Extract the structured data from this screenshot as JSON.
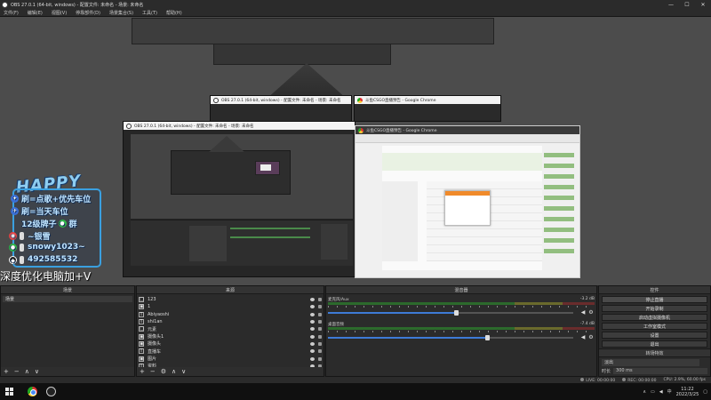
{
  "window": {
    "title": "OBS 27.0.1 (64-bit, windows) - 配置文件: 未命名 - 场景: 未命名",
    "controls": [
      "—",
      "☐",
      "✕"
    ]
  },
  "menu": [
    "文件(F)",
    "编辑(E)",
    "视图(V)",
    "停靠部件(D)",
    "场景集合(S)",
    "工具(T)",
    "帮助(H)"
  ],
  "preview": {
    "obs_window_title": "OBS 27.0.1 (64-bit, windows) - 配置文件: 未命名 - 场景: 未命名",
    "chrome_window_title": "斗鱼CSGO直播预告 - Google Chrome",
    "mini_obs_title": "OBS 27.0.1 (64-bit, windows) - 配置文件: 未命名 - 场景: 未命名",
    "mini_chrome_title": "斗鱼CSGO直播预告 - Google Chrome",
    "streamer": {
      "logo": "HAPPY",
      "lines": [
        "刷=点歌+优先车位",
        "刷=当天车位",
        "12级牌子",
        "~银雪",
        "snowy1023~",
        "492585532"
      ],
      "group_label": "群"
    },
    "caption": "深度优化电脑加+V"
  },
  "docks": {
    "scenes": {
      "header": "场景",
      "items": [
        "场景"
      ]
    },
    "sources": {
      "header": "来源",
      "items": [
        {
          "label": "123",
          "icon": "□"
        },
        {
          "label": "1",
          "icon": "▣"
        },
        {
          "label": "Abiyaoshi",
          "icon": "T"
        },
        {
          "label": "shi1an",
          "icon": "T"
        },
        {
          "label": "元素",
          "icon": "▢"
        },
        {
          "label": "摄像头1",
          "icon": "▣"
        },
        {
          "label": "摄像头",
          "icon": "▣"
        },
        {
          "label": "直播车",
          "icon": "T"
        },
        {
          "label": "图片",
          "icon": "▣"
        },
        {
          "label": "资料",
          "icon": "T"
        }
      ]
    },
    "mixer": {
      "header": "混音器",
      "channels": [
        {
          "label": "麦克风/Aux",
          "db": "-3.2 dB",
          "level": 0.52
        },
        {
          "label": "桌面音频",
          "db": "-7.4 dB",
          "level": 0.65
        }
      ]
    },
    "controls": {
      "header": "控件",
      "buttons": [
        "停止直播",
        "开始录制",
        "启动虚拟摄像机",
        "工作室模式",
        "设置",
        "退出"
      ]
    },
    "transitions": {
      "header": "转场特效",
      "type": "淡出",
      "duration_label": "时长",
      "duration_value": "300 ms"
    }
  },
  "statusbar": {
    "live": "LIVE: 00:00:00",
    "rec": "REC: 00:00:00",
    "cpu": "CPU: 2.9%, 60.00 fps"
  },
  "taskbar": {
    "time": "11:22",
    "date": "2022/3/25",
    "lang": "中"
  },
  "colors": {
    "accent": "#3aa0e0",
    "meter_green": "#2c6a2c",
    "slider_blue": "#3e7bd6"
  }
}
